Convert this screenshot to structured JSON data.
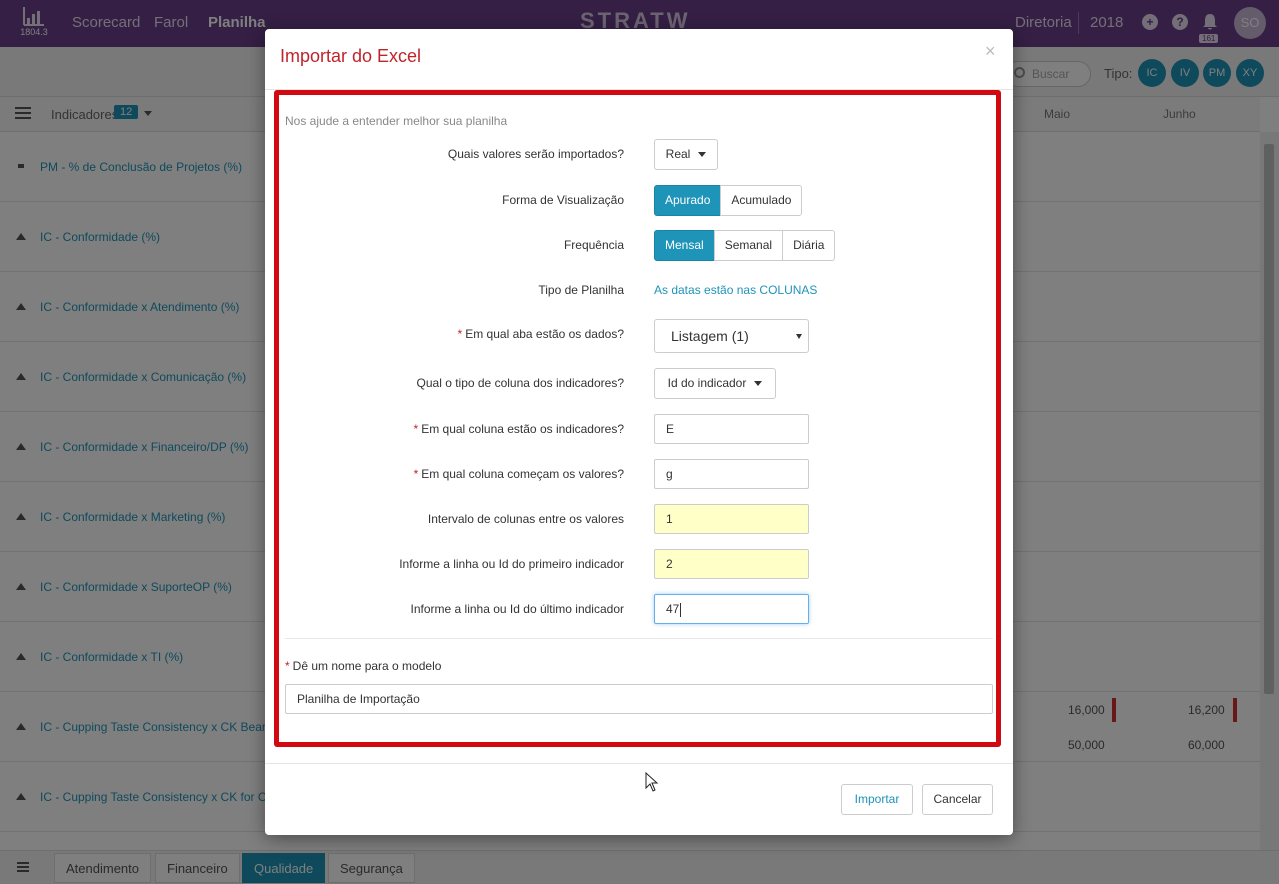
{
  "app": {
    "logo_caption": "1804.3",
    "nav": [
      "Scorecard",
      "Farol",
      "Planilha"
    ],
    "active_nav": "Planilha",
    "brand": "STRATW",
    "directory": "Diretoria",
    "year": "2018",
    "notifications": "161",
    "avatar": "SO",
    "search_placeholder": "Buscar",
    "tipo_label": "Tipo:",
    "tipo_chips": [
      "IC",
      "IV",
      "PM",
      "XY"
    ],
    "indicators_label": "Indicadores",
    "indicators_count": "12",
    "months": [
      "Maio",
      "Junho"
    ],
    "rows": [
      "PM - % de Conclusão de Projetos (%)",
      "IC - Conformidade (%)",
      "IC - Conformidade x Atendimento (%)",
      "IC - Conformidade x Comunicação (%)",
      "IC - Conformidade x Financeiro/DP (%)",
      "IC - Conformidade x Marketing (%)",
      "IC - Conformidade x SuporteOP (%)",
      "IC - Conformidade x TI (%)",
      "IC - Cupping Taste Consistency x CK Beans",
      "IC - Cupping Taste Consistency x CK for Co"
    ],
    "cell_values": {
      "maio_top": "16,000",
      "junho_top": "16,200",
      "maio_bottom": "50,000",
      "junho_bottom": "60,000"
    },
    "bottom_tabs": [
      "Atendimento",
      "Financeiro",
      "Qualidade",
      "Segurança"
    ],
    "active_bottom_tab": "Qualidade"
  },
  "modal": {
    "title": "Importar do Excel",
    "close": "×",
    "hint": "Nos ajude a entender melhor sua planilha",
    "fields": {
      "values_label": "Quais valores serão importados?",
      "values_selected": "Real",
      "view_label": "Forma de Visualização",
      "view_options": [
        "Apurado",
        "Acumulado"
      ],
      "view_selected": "Apurado",
      "freq_label": "Frequência",
      "freq_options": [
        "Mensal",
        "Semanal",
        "Diária"
      ],
      "freq_selected": "Mensal",
      "sheet_type_label": "Tipo de Planilha",
      "sheet_type_value": "As datas estão nas COLUNAS",
      "tab_label": "Em qual aba estão os dados?",
      "tab_value": "Listagem (1)",
      "col_type_label": "Qual o tipo de coluna dos indicadores?",
      "col_type_value": "Id do indicador",
      "ind_col_label": "Em qual coluna estão os indicadores?",
      "ind_col_value": "E",
      "start_col_label": "Em qual coluna começam os valores?",
      "start_col_value": "g",
      "interval_label": "Intervalo de colunas entre os valores",
      "interval_value": "1",
      "first_label": "Informe a linha ou Id do primeiro indicador",
      "first_value": "2",
      "last_label": "Informe a linha ou Id do último indicador",
      "last_value": "47"
    },
    "model_label": "Dê um nome para o modelo",
    "model_value": "Planilha de Importação",
    "required_mark": "*",
    "import_button": "Importar",
    "cancel_button": "Cancelar"
  },
  "colors": {
    "accent": "#1e94b8",
    "brand": "#6b3e8a",
    "title_red": "#c0242b",
    "frame_red": "#d10a11"
  }
}
